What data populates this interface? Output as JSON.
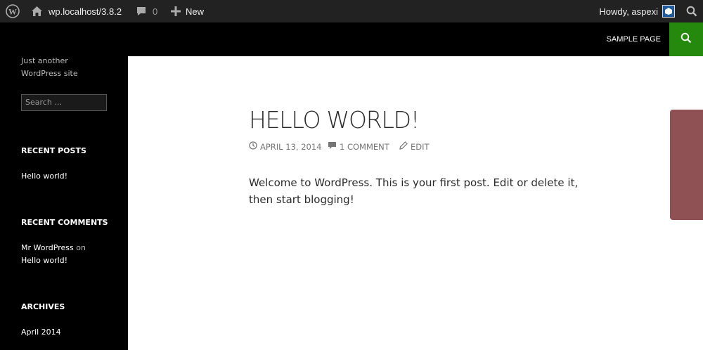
{
  "admin_bar": {
    "site": "wp.localhost/3.8.2",
    "comments_count": "0",
    "new_label": "New",
    "howdy": "Howdy, aspexi"
  },
  "header": {
    "nav_item": "SAMPLE PAGE"
  },
  "sidebar": {
    "description": "Just another WordPress site",
    "search_placeholder": "Search …",
    "recent_posts": {
      "title": "RECENT POSTS",
      "items": [
        "Hello world!"
      ]
    },
    "recent_comments": {
      "title": "RECENT COMMENTS",
      "author": "Mr WordPress",
      "on": "on",
      "post": "Hello world!"
    },
    "archives": {
      "title": "ARCHIVES",
      "items": [
        "April 2014"
      ]
    }
  },
  "post": {
    "title": "HELLO WORLD!",
    "date": "APRIL 13, 2014",
    "comments": "1 COMMENT",
    "edit": "EDIT",
    "body": "Welcome to WordPress. This is your first post. Edit or delete it, then start blogging!"
  },
  "colors": {
    "admin_bar": "#222222",
    "header_bg": "#000000",
    "search_green": "#24890d",
    "side_tab": "#8f5154"
  }
}
